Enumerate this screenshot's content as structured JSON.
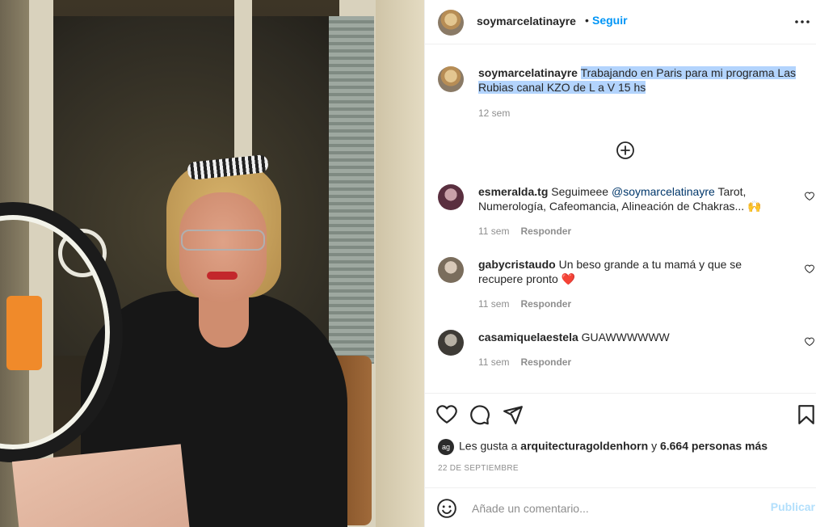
{
  "post": {
    "author": "soymarcelatinayre",
    "follow_label": "Seguir",
    "separator": "•",
    "caption_author": "soymarcelatinayre",
    "caption_text": "Trabajando en Paris para mi programa Las Rubias canal KZO de L a V 15 hs",
    "caption_time": "12 sem"
  },
  "comments": [
    {
      "user": "esmeralda.tg",
      "text": "Seguimeee",
      "mention": "@soymarcelatinayre",
      "text_after": "Tarot, Numerología, Cafeomancia, Alineación de Chakras...",
      "emoji": "🙌",
      "time": "11 sem",
      "reply_label": "Responder"
    },
    {
      "user": "gabycristaudo",
      "text": "Un beso grande a tu mamá y que se recupere pronto",
      "emoji": "❤️",
      "time": "11 sem",
      "reply_label": "Responder"
    },
    {
      "user": "casamiquelaestela",
      "text": "GUAWWWWWW",
      "time": "11 sem",
      "reply_label": "Responder"
    }
  ],
  "likes": {
    "prefix": "Les gusta a",
    "liker": "arquitecturagoldenhorn",
    "joiner": "y",
    "others": "6.664 personas más",
    "liker_avatar_text": "ag"
  },
  "date": "22 DE SEPTIEMBRE",
  "comment_box": {
    "placeholder": "Añade un comentario...",
    "post_label": "Publicar"
  },
  "colors": {
    "accent": "#0095f6",
    "highlight": "#b3d4fd",
    "muted": "#8e8e8e",
    "publish_disabled": "#b2dffc"
  },
  "icons": [
    "more-options-icon",
    "add-circle-icon",
    "heart-icon",
    "comment-icon",
    "share-icon",
    "bookmark-icon",
    "smile-icon"
  ]
}
